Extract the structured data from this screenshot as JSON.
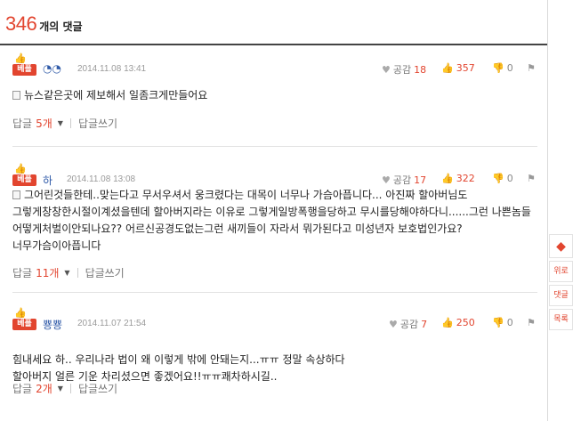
{
  "header": {
    "count": "346",
    "label": "개의 댓글"
  },
  "comments": [
    {
      "badge": "베플",
      "nick": "◔◔",
      "date": "2014.11.08 13:41",
      "gongam_label": "공감",
      "gongam_count": "18",
      "likes": "357",
      "dislikes": "0",
      "text": "뉴스같은곳에 제보해서 일좀크게만들어요",
      "reply_label": "답글",
      "reply_count": "5개",
      "write_label": "답글쓰기"
    },
    {
      "badge": "베플",
      "nick": "하",
      "date": "2014.11.08 13:08",
      "gongam_label": "공감",
      "gongam_count": "17",
      "likes": "322",
      "dislikes": "0",
      "text": "그어린것들한테..맞는다고 무서우셔서 웅크렸다는 대목이 너무나 가슴아픕니다... 아진짜 할아버님도 그렇게창창한시절이계셨을텐데 할아버지라는 이유로 그렇게일방폭행을당하고 무시를당해야하다니......그런 나쁜놈들 어떻게처벌이안되나요?? 어르신공경도없는그런 새끼들이 자라서 뭐가된다고 미성년자 보호법인가요? 너무가슴이아픕니다",
      "reply_label": "답글",
      "reply_count": "11개",
      "write_label": "답글쓰기"
    },
    {
      "badge": "베플",
      "nick": "뿅뿅",
      "date": "2014.11.07 21:54",
      "gongam_label": "공감",
      "gongam_count": "7",
      "likes": "250",
      "dislikes": "0",
      "text": "힘내세요 하.. 우리나라 법이 왜 이렇게 밖에 안돼는지...ㅠㅠ 정말 속상하다\n할아버지 얼른 기운 차리셨으면 좋겠어요!!ㅠㅠ쾌차하시길..",
      "reply_label": "답글",
      "reply_count": "2개",
      "write_label": "답글쓰기"
    }
  ],
  "side_nav": {
    "up": "위로",
    "comments": "댓글",
    "list": "목록"
  },
  "colors": {
    "accent": "#e2452f",
    "nick": "#2f5aa8",
    "muted": "#9a9a9a"
  },
  "icons": [
    "thumbs-up-icon",
    "heart-icon",
    "thumbs-down-icon",
    "report-icon",
    "document-icon",
    "caret-down-icon",
    "cube-icon"
  ]
}
